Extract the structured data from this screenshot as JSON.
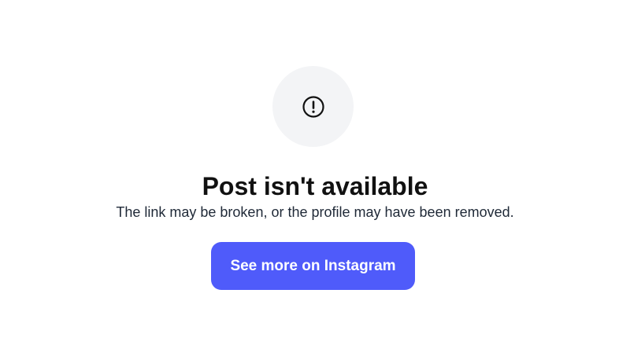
{
  "error": {
    "icon": "exclamation-circle-icon",
    "title": "Post isn't available",
    "message": "The link may be broken, or the profile may have been removed.",
    "action_label": "See more on Instagram"
  },
  "colors": {
    "icon_background": "#f3f4f6",
    "icon_stroke": "#111111",
    "button_background": "#4f5bfa",
    "button_text": "#ffffff",
    "title_text": "#111111",
    "message_text": "#1f2937"
  }
}
